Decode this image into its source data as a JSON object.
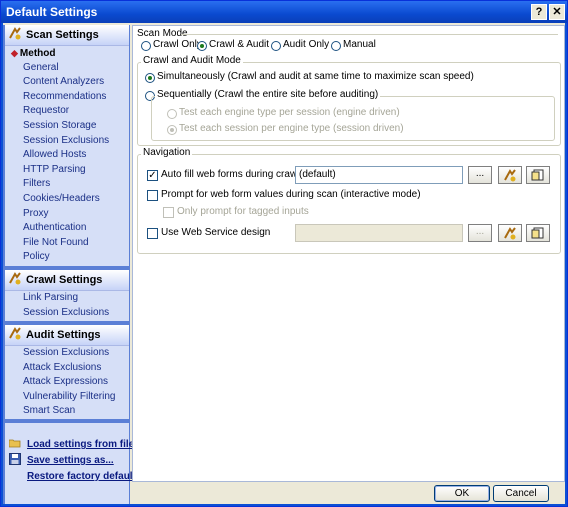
{
  "window": {
    "title": "Default Settings",
    "help_glyph": "?",
    "close_glyph": "✕"
  },
  "sidebar": {
    "scan_settings": {
      "header": "Scan Settings",
      "selected": "Method",
      "items": [
        "General",
        "Content Analyzers",
        "Recommendations",
        "Requestor",
        "Session Storage",
        "Session Exclusions",
        "Allowed Hosts",
        "HTTP Parsing",
        "Filters",
        "Cookies/Headers",
        "Proxy",
        "Authentication",
        "File Not Found",
        "Policy"
      ]
    },
    "crawl_settings": {
      "header": "Crawl Settings",
      "items": [
        "Link Parsing",
        "Session Exclusions"
      ]
    },
    "audit_settings": {
      "header": "Audit Settings",
      "items": [
        "Session Exclusions",
        "Attack Exclusions",
        "Attack Expressions",
        "Vulnerability Filtering",
        "Smart Scan"
      ]
    },
    "links": {
      "load": "Load settings from file...",
      "save": "Save settings as...",
      "restore": "Restore factory defaults"
    }
  },
  "scan_mode": {
    "label": "Scan Mode",
    "options": [
      "Crawl Only",
      "Crawl & Audit",
      "Audit Only",
      "Manual"
    ],
    "selected": "Crawl & Audit"
  },
  "crawl_audit_mode": {
    "label": "Crawl and Audit Mode",
    "simultaneous": "Simultaneously (Crawl and audit at same time to maximize scan speed)",
    "sequential": "Sequentially (Crawl the entire site before auditing)",
    "engine_driven": "Test each engine type per session (engine driven)",
    "session_driven": "Test each session per engine type (session driven)",
    "selected": "Simultaneously"
  },
  "navigation": {
    "label": "Navigation",
    "auto_fill_label": "Auto fill web forms during crawl",
    "auto_fill_checked": true,
    "auto_fill_value": "(default)",
    "prompt_label": "Prompt for web form values during scan (interactive mode)",
    "prompt_checked": false,
    "only_tagged_label": "Only prompt for tagged inputs",
    "web_service_label": "Use Web Service design",
    "web_service_checked": false,
    "web_service_value": "",
    "browse_label": "..."
  },
  "buttons": {
    "ok": "OK",
    "cancel": "Cancel"
  }
}
